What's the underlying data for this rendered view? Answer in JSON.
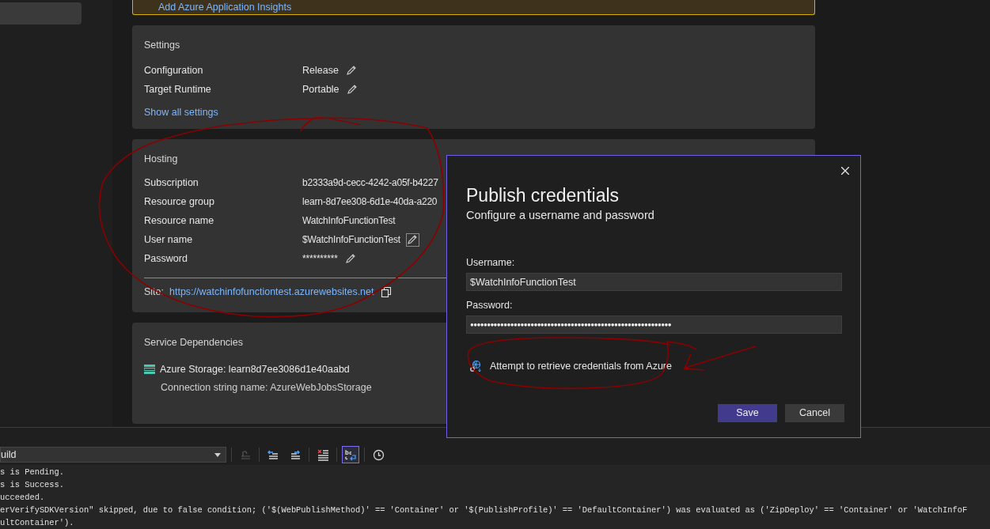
{
  "insights_banner": {
    "link": "Add Azure Application Insights"
  },
  "settings": {
    "title": "Settings",
    "rows": [
      {
        "label": "Configuration",
        "value": "Release",
        "editable": true
      },
      {
        "label": "Target Runtime",
        "value": "Portable",
        "editable": true
      }
    ],
    "link": "Show all settings"
  },
  "hosting": {
    "title": "Hosting",
    "rows": [
      {
        "label": "Subscription",
        "value": "b2333a9d-cecc-4242-a05f-b4227",
        "editable": false
      },
      {
        "label": "Resource group",
        "value": "learn-8d7ee308-6d1e-40da-a220",
        "editable": false
      },
      {
        "label": "Resource name",
        "value": "WatchInfoFunctionTest",
        "editable": false
      },
      {
        "label": "User name",
        "value": "$WatchInfoFunctionTest",
        "editable": true,
        "focused": true
      },
      {
        "label": "Password",
        "value": "**********",
        "editable": true,
        "focused": false
      }
    ],
    "site_label": "Site:",
    "site_url": "https://watchinfofunctiontest.azurewebsites.net"
  },
  "service_dependencies": {
    "title": "Service Dependencies",
    "items": [
      {
        "name": "Azure Storage: learn8d7ee3086d1e40aabd",
        "detail": "Connection string name: AzureWebJobsStorage"
      }
    ]
  },
  "output": {
    "dropdown": "uild",
    "toolbar": [
      {
        "kind": "align",
        "disabled": true,
        "selected": false
      },
      {
        "kind": "prev",
        "disabled": false,
        "selected": false
      },
      {
        "kind": "next",
        "disabled": false,
        "selected": false
      },
      {
        "kind": "clear",
        "disabled": false,
        "selected": false
      },
      {
        "kind": "wrap",
        "disabled": false,
        "selected": true
      },
      {
        "kind": "clock",
        "disabled": false,
        "selected": false
      }
    ],
    "lines": [
      "s is Pending.",
      "s is Success.",
      "ucceeded.",
      "erVerifySDKVersion\" skipped, due to false condition; ('$(WebPublishMethod)' == 'Container' or '$(PublishProfile)' == 'DefaultContainer') was evaluated as ('ZipDeploy' == 'Container' or 'WatchInfoF",
      "ultContainer')."
    ]
  },
  "dialog": {
    "title": "Publish credentials",
    "subtitle": "Configure a username and password",
    "username_label": "Username:",
    "username": "$WatchInfoFunctionTest",
    "password_label": "Password:",
    "password": "●●●●●●●●●●●●●●●●●●●●●●●●●●●●●●●●●●●●●●●●●●●●●●●●●●●●●●●●●●●●",
    "retrieve": "Attempt to retrieve credentials from Azure",
    "save": "Save",
    "cancel": "Cancel"
  }
}
